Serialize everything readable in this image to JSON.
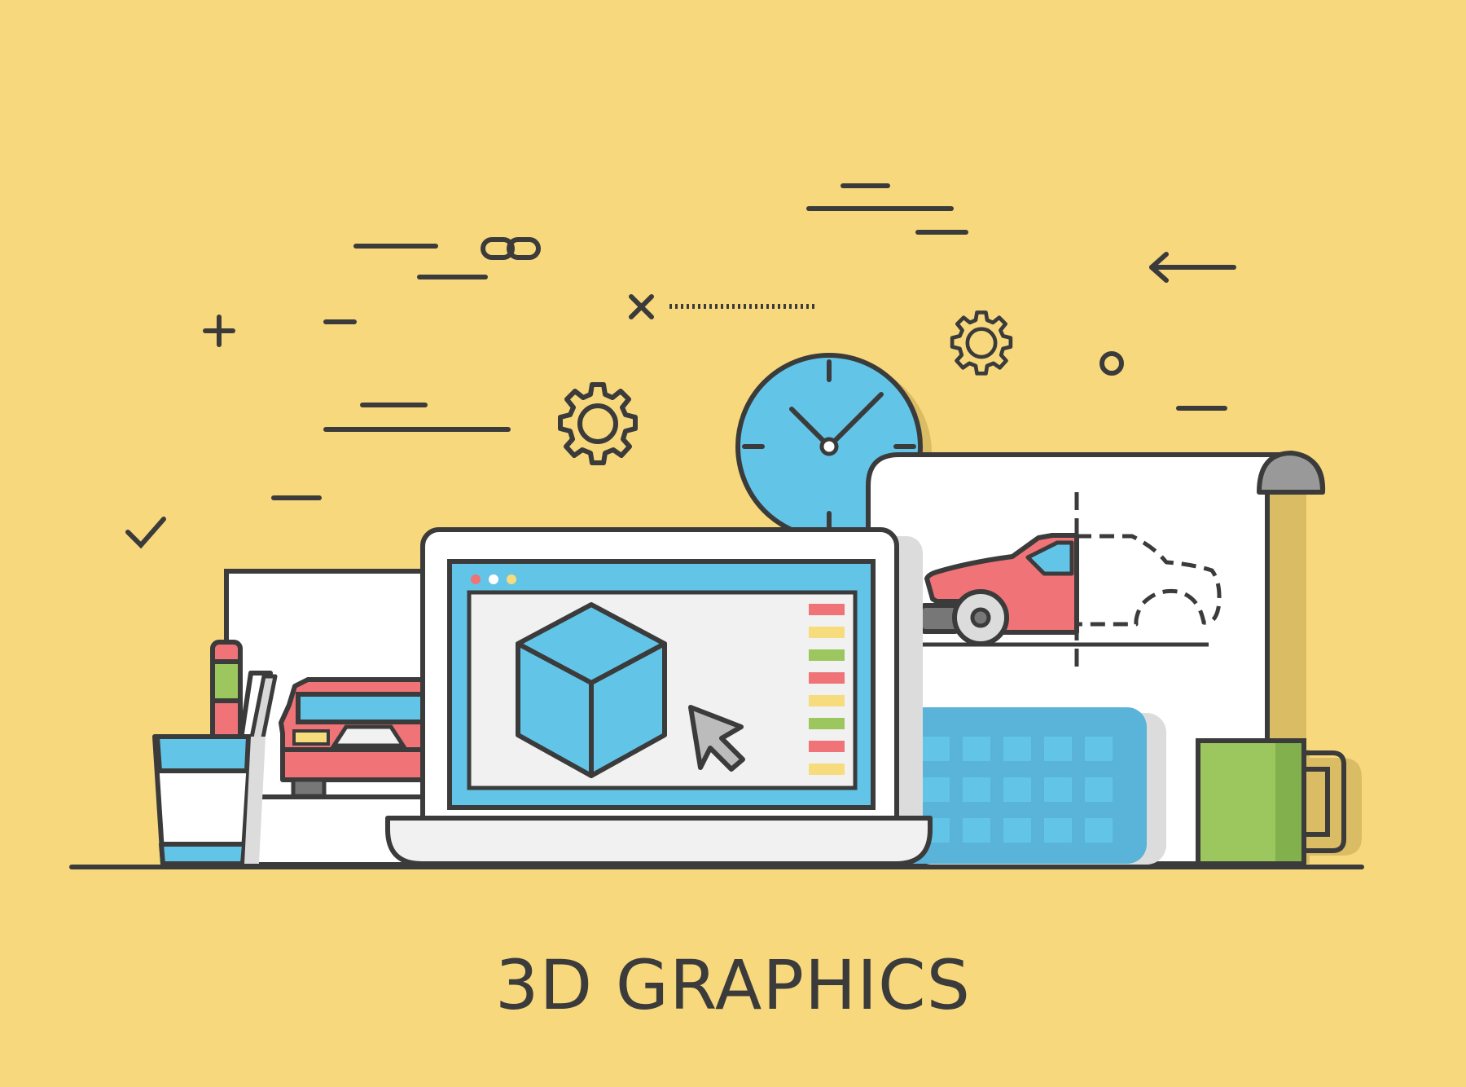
{
  "title": "3D GRAPHICS",
  "colors": {
    "background": "#f8d87c",
    "outline": "#3b3b3b",
    "blue": "#62c5e8",
    "red": "#ef7377",
    "green": "#9cc65e",
    "yellow": "#f7dc7d",
    "light_gray": "#f1f1f1",
    "gray": "#dcdcdc",
    "shadow": "#d9bc63"
  },
  "icons": [
    "plus-icon",
    "minus-icon",
    "check-icon",
    "close-icon",
    "chain-link-icon",
    "gear-icon",
    "clock-icon",
    "circle-icon",
    "arrow-left-icon",
    "cube-icon",
    "cursor-icon",
    "car-icon",
    "blueprint-icon",
    "laptop-icon",
    "keyboard-icon",
    "mug-icon",
    "pencil-cup-icon"
  ]
}
